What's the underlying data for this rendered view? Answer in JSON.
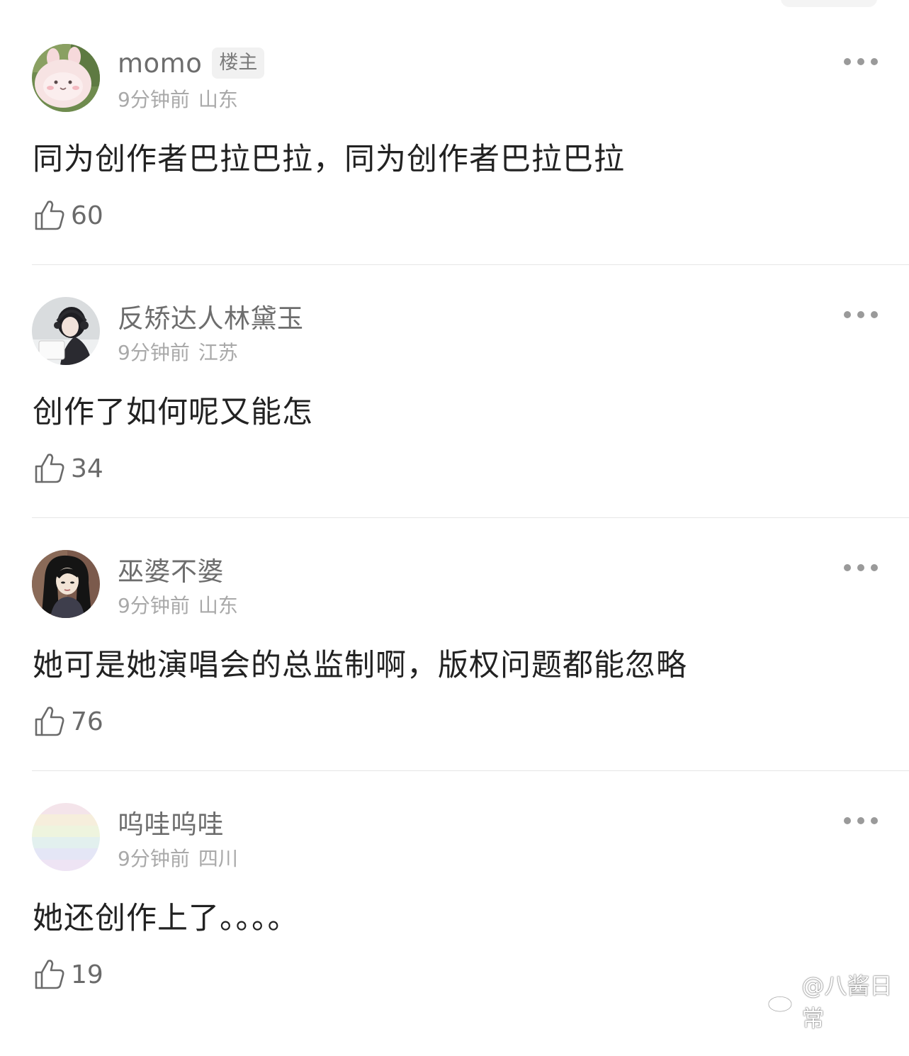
{
  "comments": [
    {
      "username": "momo",
      "badge": "楼主",
      "time": "9分钟前",
      "location": "山东",
      "text": "同为创作者巴拉巴拉，同为创作者巴拉巴拉",
      "likes": "60",
      "avatar_icon": "bunny-plush-avatar"
    },
    {
      "username": "反矫达人林黛玉",
      "time": "9分钟前",
      "location": "江苏",
      "text": "创作了如何呢又能怎",
      "likes": "34",
      "avatar_icon": "girl-headphones-avatar"
    },
    {
      "username": "巫婆不婆",
      "time": "9分钟前",
      "location": "山东",
      "text": "她可是她演唱会的总监制啊，版权问题都能忽略",
      "likes": "76",
      "avatar_icon": "cartoon-girl-avatar"
    },
    {
      "username": "呜哇呜哇",
      "time": "9分钟前",
      "location": "四川",
      "text": "她还创作上了。。。。",
      "likes": "19",
      "avatar_icon": "pastel-rainbow-avatar"
    }
  ],
  "watermark": {
    "text": "@八酱日常",
    "icon": "weibo-logo-icon"
  },
  "colors": {
    "username": "#6d6d6d",
    "meta": "#a9a9a9",
    "content": "#222222",
    "divider": "#e6e6e6",
    "badge_bg": "#f1f1f1"
  }
}
